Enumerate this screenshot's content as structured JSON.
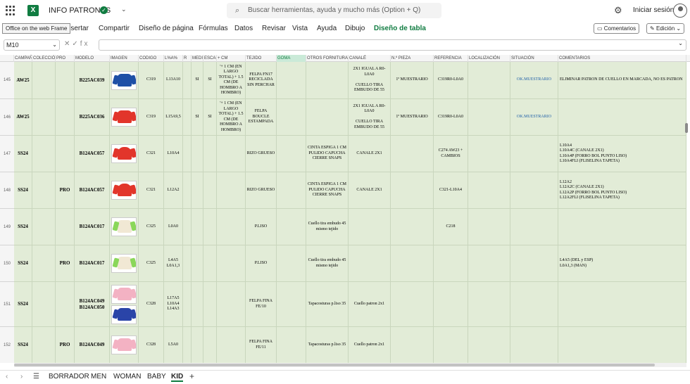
{
  "app": {
    "title": "INFO PATRONES",
    "search_placeholder": "Buscar herramientas, ayuda y mucho más (Option + Q)",
    "signin": "Iniciar sesión"
  },
  "ribbon": {
    "tooltip": "Office on the web Frame",
    "tabs": [
      "Insertar",
      "Compartir",
      "Diseño de página",
      "Fórmulas",
      "Datos",
      "Revisar",
      "Vista",
      "Ayuda",
      "Dibujo",
      "Diseño de tabla"
    ],
    "comments": "Comentarios",
    "edit": "Edición"
  },
  "formula": {
    "cell": "M10",
    "fx": "fx"
  },
  "columns": [
    "CAMPAÑA",
    "COLECCIÓN",
    "PRO",
    "MODELO",
    "IMAGEN",
    "CODIGO",
    "L%A%",
    "R",
    "MEDI",
    "ESCAI",
    "+ CM",
    "TEJIDO",
    "GOMA",
    "OTROS FORNITURAS",
    "CANALÉ",
    "N.º PIEZA",
    "REFERENCIA",
    "LOCALIZACIÓN",
    "SITUACIÓN",
    "COMENTARIOS"
  ],
  "rows": [
    {
      "num": "145",
      "camp": "AW25",
      "pro": "",
      "modelo": "B225AC039",
      "img": "g-blue",
      "codigo": "C319",
      "la": "L13A10",
      "medi": "SI",
      "escai": "SI",
      "cm": "'+ 1 CM (EN LARGO TOTAL) + 1.5 CM (DE HOMBRO A HOMBRO)",
      "tejido": "FELPA FN17 RECICLADA SIN PERCHAR",
      "otros": "",
      "canale": "2X1 IGUAL A R0-L0A0\n\nCUELLO TIRA EMBUDO DE 55",
      "pieza": "1º MUESTRARIO",
      "ref": "C319R0-L0A0",
      "sit": "OK.MUESTRARIO",
      "com": "ELIMINAR PATRON DE CUELLO EN MARCADA, NO ES PATRON"
    },
    {
      "num": "146",
      "camp": "AW25",
      "pro": "",
      "modelo": "B225AC036",
      "img": "g-red",
      "codigo": "C319",
      "la": "L15A9,5",
      "medi": "SI",
      "escai": "SI",
      "cm": "'+ 1 CM (EN LARGO TOTAL) + 1.5 CM (DE HOMBRO A HOMBRO)",
      "tejido": "FELPA BOUCLE ESTAMPADA",
      "otros": "",
      "canale": "2X1 IGUAL A R0-L0A0\n\nCUELLO TIRA EMBUDO DE 55",
      "pieza": "1º MUESTRARIO",
      "ref": "C319R0-L0A0",
      "sit": "OK.MUESTRARIO",
      "com": ""
    },
    {
      "num": "147",
      "camp": "SS24",
      "pro": "",
      "modelo": "B124AC057",
      "img": "g-redhood",
      "codigo": "C321",
      "la": "L10A4",
      "medi": "",
      "escai": "",
      "cm": "",
      "tejido": "RIZO GRUESO",
      "otros": "CINTA ESPIGA 1 CM PULIDO CAPUCHA CIERRE SNAPS",
      "canale": "CANALE 2X1",
      "pieza": "",
      "ref": "C274 AW23 + CAMBIOS",
      "sit": "",
      "com": "L10A4\nL10A4C (CANALE 2X1)\nL10A4P (FORRO BOL PUNTO LISO)\nL10A4FLI (FLISELINA TAPETA)"
    },
    {
      "num": "148",
      "camp": "SS24",
      "pro": "PRO",
      "modelo": "B124AC057",
      "img": "g-redhood",
      "codigo": "C321",
      "la": "L12A2",
      "medi": "",
      "escai": "",
      "cm": "",
      "tejido": "RIZO GRUESO",
      "otros": "CINTA ESPIGA 1 CM PULIDO CAPUCHA CIERRE SNAPS",
      "canale": "CANALE 2X1",
      "pieza": "",
      "ref": "C321-L10A4",
      "sit": "",
      "com": "L12A2\nL12A2C (CANALE 2X1)\nL12A2P (FORRO BOL PUNTO LISO)\nL12A2FLI (FLISELINA TAPETA)"
    },
    {
      "num": "149",
      "camp": "SS24",
      "pro": "",
      "modelo": "B124AC017",
      "img": "g-cream",
      "codigo": "C325",
      "la": "L0A0",
      "medi": "",
      "escai": "",
      "cm": "",
      "tejido": "P.LISO",
      "otros": "Cuello tira embudo 45 mismo tejido",
      "canale": "",
      "pieza": "",
      "ref": "C218",
      "sit": "",
      "com": ""
    },
    {
      "num": "150",
      "camp": "SS24",
      "pro": "PRO",
      "modelo": "B124AC017",
      "img": "g-cream",
      "codigo": "C325",
      "la": "L4A5\nL0A1,3",
      "medi": "",
      "escai": "",
      "cm": "",
      "tejido": "P.LISO",
      "otros": "Cuello tira embudo 45 mismo tejido",
      "canale": "",
      "pieza": "",
      "ref": "",
      "sit": "",
      "com": "L4A5 (DEL y ESP)\nL0A1,3 (MAN)"
    },
    {
      "num": "151",
      "camp": "SS24",
      "pro": "",
      "modelo": "B124AC049\nB124AC050",
      "img": "g-pink",
      "img2": "g-navy",
      "codigo": "C328",
      "la": "L17A5\nL10A4\nL14A3",
      "medi": "",
      "escai": "",
      "cm": "",
      "tejido": "FELPA FINA FE/10",
      "otros": "Tapacosturas p.liso 35",
      "canale": "Cuello patron 2x1",
      "pieza": "",
      "ref": "",
      "sit": "",
      "com": ""
    },
    {
      "num": "152",
      "camp": "SS24",
      "pro": "PRO",
      "modelo": "B124AC049",
      "img": "g-pink",
      "codigo": "C328",
      "la": "L5A0",
      "medi": "",
      "escai": "",
      "cm": "",
      "tejido": "FELPA FINA FE/11",
      "otros": "Tapacosturas p.liso 35",
      "canale": "Cuello patron 2x1",
      "pieza": "",
      "ref": "",
      "sit": "",
      "com": ""
    }
  ],
  "sheets": [
    "BORRADOR",
    "MEN",
    "WOMAN",
    "BABY",
    "KID"
  ],
  "active_sheet": "KID"
}
